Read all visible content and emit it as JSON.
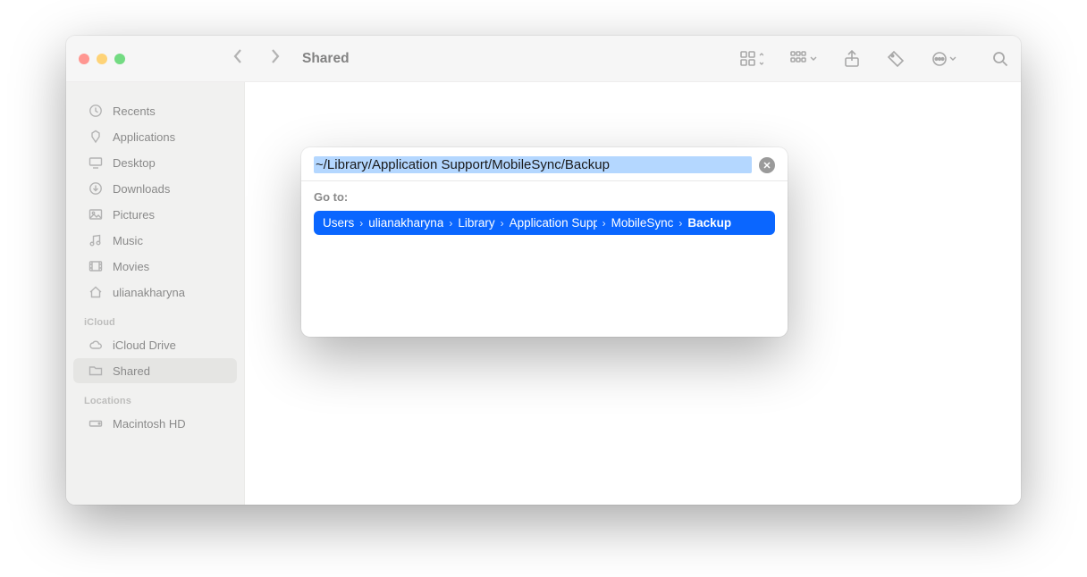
{
  "window": {
    "title": "Shared"
  },
  "sidebar": {
    "favorites": [
      {
        "icon": "clock-icon",
        "label": "Recents"
      },
      {
        "icon": "app-icon",
        "label": "Applications"
      },
      {
        "icon": "desktop-icon",
        "label": "Desktop"
      },
      {
        "icon": "download-icon",
        "label": "Downloads"
      },
      {
        "icon": "pictures-icon",
        "label": "Pictures"
      },
      {
        "icon": "music-icon",
        "label": "Music"
      },
      {
        "icon": "movies-icon",
        "label": "Movies"
      },
      {
        "icon": "home-icon",
        "label": "ulianakharyna"
      }
    ],
    "icloud_heading": "iCloud",
    "icloud": [
      {
        "icon": "cloud-icon",
        "label": "iCloud Drive"
      },
      {
        "icon": "folder-icon",
        "label": "Shared",
        "selected": true
      }
    ],
    "locations_heading": "Locations",
    "locations": [
      {
        "icon": "disk-icon",
        "label": "Macintosh HD"
      }
    ]
  },
  "goto": {
    "input": "~/Library/Application Support/MobileSync/Backup",
    "label": "Go to:",
    "path": [
      "Users",
      "ulianakharyna",
      "Library",
      "Application Support",
      "MobileSync",
      "Backup"
    ]
  }
}
